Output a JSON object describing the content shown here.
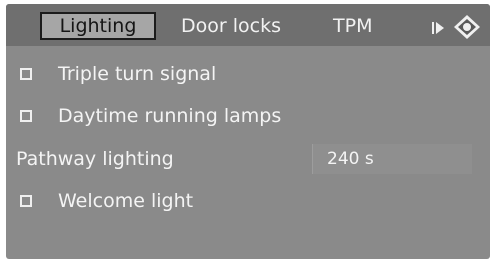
{
  "tabs": [
    {
      "label": "Lighting",
      "selected": true
    },
    {
      "label": "Door locks",
      "selected": false
    },
    {
      "label": "TPM",
      "selected": false
    }
  ],
  "icons": {
    "next": "arrow-right-icon",
    "navigate": "joystick-icon"
  },
  "settings": [
    {
      "label": "Triple turn signal",
      "type": "checkbox",
      "checked": false
    },
    {
      "label": "Daytime running lamps",
      "type": "checkbox",
      "checked": false
    },
    {
      "label": "Pathway lighting",
      "type": "value",
      "value": "240 s"
    },
    {
      "label": "Welcome light",
      "type": "checkbox",
      "checked": false
    }
  ],
  "colors": {
    "screen_bg": "#8a8a8a",
    "tabbar_bg": "#6f6f6f",
    "selected_tab_bg": "#a6a6a6",
    "text": "#f4f4f4"
  }
}
